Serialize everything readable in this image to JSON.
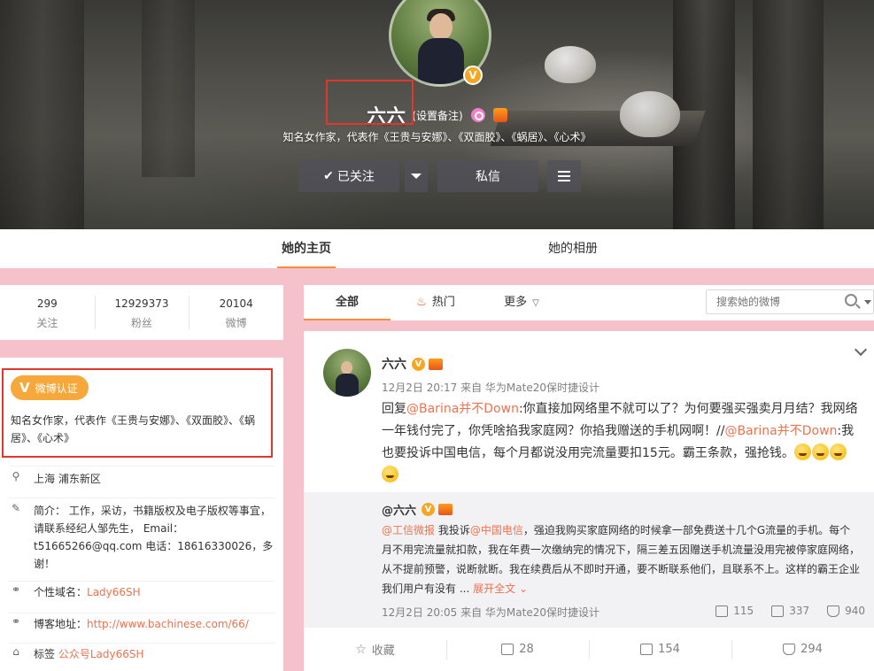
{
  "profile": {
    "name": "六六",
    "remark": "(设置备注)",
    "intro": "知名女作家，代表作《王贵与安娜》、《双面胶》、《蜗居》、《心术》",
    "verified_badge": "V",
    "follow_label": "已关注",
    "message_label": "私信"
  },
  "profile_tabs": [
    {
      "label": "她的主页",
      "active": true
    },
    {
      "label": "她的相册",
      "active": false
    }
  ],
  "stats": [
    {
      "value": "299",
      "label": "关注"
    },
    {
      "value": "12929373",
      "label": "粉丝"
    },
    {
      "value": "20104",
      "label": "微博"
    }
  ],
  "info": {
    "verify_tag": "微博认证",
    "verify_desc": "知名女作家，代表作《王贵与安娜》、《双面胶》、《蜗居》、《心术》",
    "location": "上海 浦东新区",
    "bio": "简介： 工作，采访，书籍版权及电子版权等事宜，请联系经纪人邹先生， Email： t51665266@qq.com 电话：18616330026，多谢！",
    "domain_label": "个性域名：",
    "domain_value": "Lady66SH",
    "blog_label": "博客地址：",
    "blog_value": "http://www.bachinese.com/66/",
    "tags_label": "标签",
    "tags_value": "公众号Lady66SH"
  },
  "feed_tabs": {
    "all": "全部",
    "hot": "热门",
    "more": "更多",
    "search_placeholder": "搜索她的微博"
  },
  "post": {
    "author": "六六",
    "meta": "12月2日 20:17 来自 华为Mate20保时捷设计",
    "reply_prefix": "回复",
    "mention1": "@Barina并不Down",
    "text1": ":你直接加网络里不就可以了？为何要强买强卖月月结？我网络一年钱付完了，你凭啥掐我家庭网？你掐我赠送的手机网啊！//",
    "mention2": "@Barina并不Down",
    "text2": ":我也要投诉中国电信，每个月都说没用完流量要扣15元。霸王条款，强抢钱。",
    "repost": {
      "author": "@六六",
      "mention_a": "@工信微报",
      "text_a": " 我投诉",
      "mention_b": "@中国电信",
      "text_b": "，强迫我购买家庭网络的时候拿一部免费送十几个G流量的手机。每个月不用完流量就扣款，我在年费一次缴纳完的情况下，隔三差五因赠送手机流量没用完被停家庭网络，从不提前预警，说断就断。我在续费后从不即时开通，要不断联系他们，且联系不上。这样的霸王企业我们用户有没有 ...",
      "expand": "展开全文",
      "meta": "12月2日 20:05 来自 华为Mate20保时捷设计",
      "reposts": "115",
      "comments": "337",
      "likes": "940"
    },
    "actions": {
      "favorite": "收藏",
      "reposts": "28",
      "comments": "154",
      "likes": "294"
    }
  },
  "colors": {
    "accent": "#f98c3a",
    "link": "#eb7350",
    "highlight_box": "#e0362c",
    "page_bg": "#f5c2cb",
    "verify_tag": "#f7a83a"
  }
}
